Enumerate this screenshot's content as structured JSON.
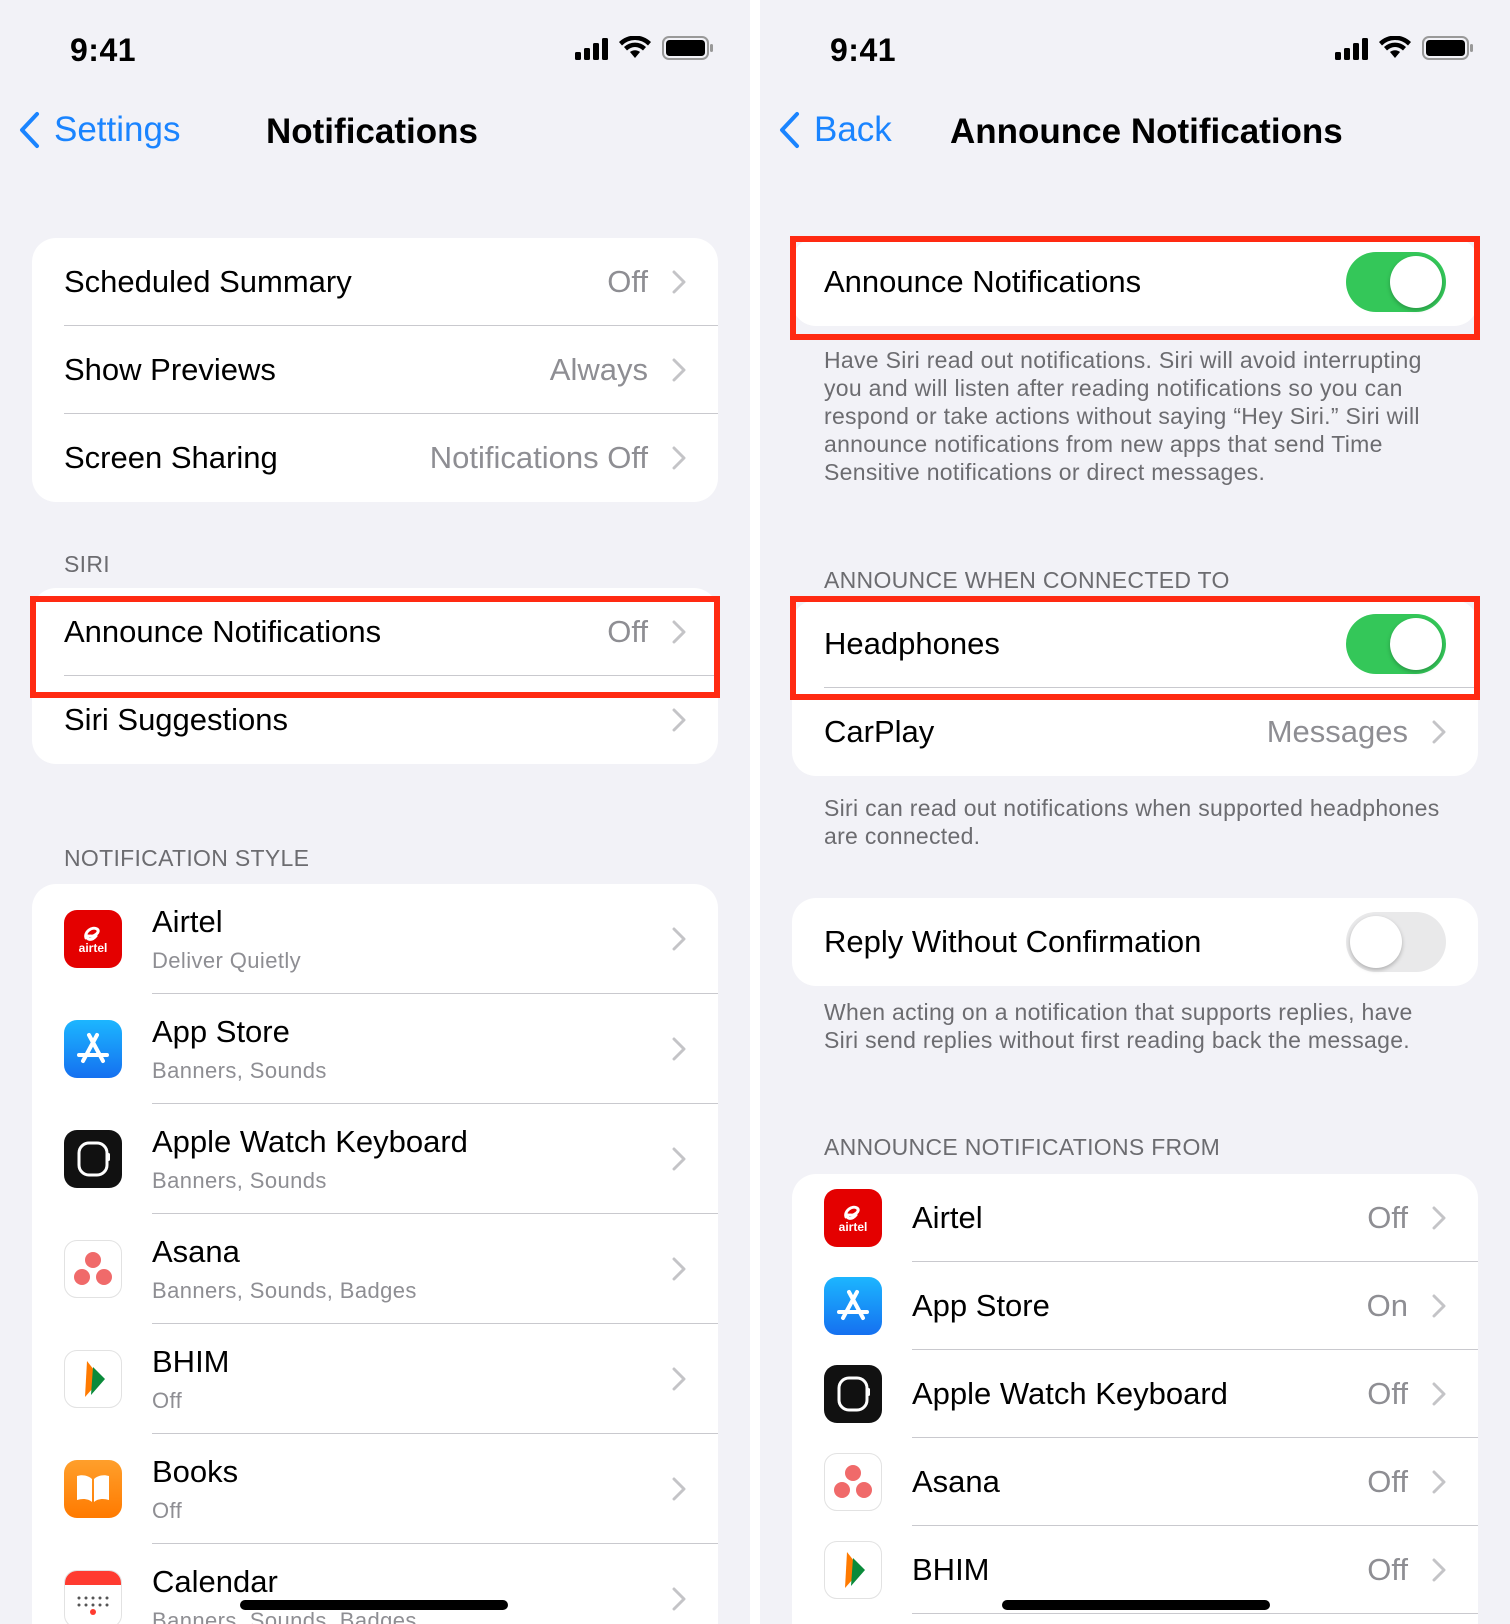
{
  "left": {
    "time": "9:41",
    "back_label": "Settings",
    "title": "Notifications",
    "top_rows": [
      {
        "label": "Scheduled Summary",
        "value": "Off"
      },
      {
        "label": "Show Previews",
        "value": "Always"
      },
      {
        "label": "Screen Sharing",
        "value": "Notifications Off"
      }
    ],
    "siri_header": "SIRI",
    "siri_rows": [
      {
        "label": "Announce Notifications",
        "value": "Off"
      },
      {
        "label": "Siri Suggestions",
        "value": ""
      }
    ],
    "style_header": "NOTIFICATION STYLE",
    "apps": [
      {
        "name": "Airtel",
        "sub": "Deliver Quietly",
        "icon": "airtel-icon"
      },
      {
        "name": "App Store",
        "sub": "Banners, Sounds",
        "icon": "app-store-icon"
      },
      {
        "name": "Apple Watch Keyboard",
        "sub": "Banners, Sounds",
        "icon": "apple-watch-icon"
      },
      {
        "name": "Asana",
        "sub": "Banners, Sounds, Badges",
        "icon": "asana-icon"
      },
      {
        "name": "BHIM",
        "sub": "Off",
        "icon": "bhim-icon"
      },
      {
        "name": "Books",
        "sub": "Off",
        "icon": "books-icon"
      },
      {
        "name": "Calendar",
        "sub": "Banners, Sounds, Badges",
        "icon": "calendar-icon"
      }
    ]
  },
  "right": {
    "time": "9:41",
    "back_label": "Back",
    "title": "Announce Notifications",
    "announce": {
      "label": "Announce Notifications",
      "on": true
    },
    "announce_footer": "Have Siri read out notifications. Siri will avoid interrupting you and will listen after reading notifications so you can respond or take actions without saying “Hey Siri.” Siri will announce notifications from new apps that send Time Sensitive notifications or direct messages.",
    "connected_header": "ANNOUNCE WHEN CONNECTED TO",
    "headphones": {
      "label": "Headphones",
      "on": true
    },
    "carplay": {
      "label": "CarPlay",
      "value": "Messages"
    },
    "connected_footer": "Siri can read out notifications when supported headphones are connected.",
    "reply": {
      "label": "Reply Without Confirmation",
      "on": false
    },
    "reply_footer": "When acting on a notification that supports replies, have Siri send replies without first reading back the message.",
    "from_header": "ANNOUNCE NOTIFICATIONS FROM",
    "apps": [
      {
        "name": "Airtel",
        "value": "Off"
      },
      {
        "name": "App Store",
        "value": "On"
      },
      {
        "name": "Apple Watch Keyboard",
        "value": "Off"
      },
      {
        "name": "Asana",
        "value": "Off"
      },
      {
        "name": "BHIM",
        "value": "Off"
      }
    ]
  },
  "colors": {
    "accent": "#1a84ff",
    "toggle_on": "#34c759",
    "highlight": "#ff2a12",
    "background": "#f2f2f7"
  },
  "airtel_icon_text": "airtel"
}
